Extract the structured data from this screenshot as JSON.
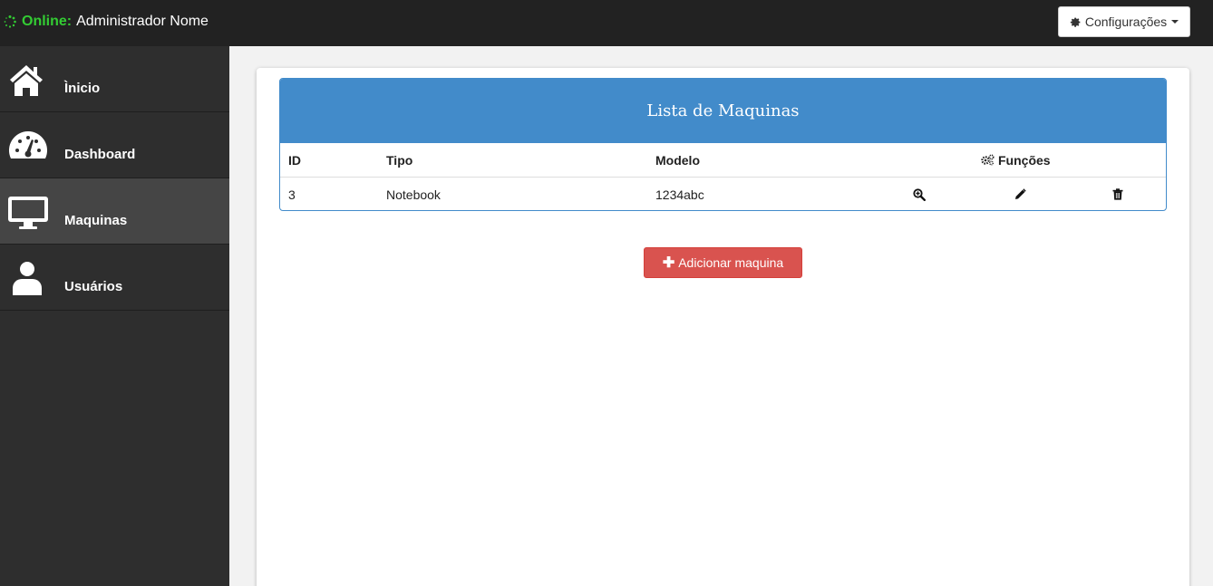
{
  "topbar": {
    "online_label": "Online:",
    "user_name": "Administrador Nome",
    "config_label": "Configurações"
  },
  "sidebar": {
    "items": [
      {
        "label": "Ìnicio",
        "icon": "home-icon"
      },
      {
        "label": "Dashboard",
        "icon": "dashboard-icon"
      },
      {
        "label": "Maquinas",
        "icon": "monitor-icon",
        "active": true
      },
      {
        "label": "Usuários",
        "icon": "user-icon"
      }
    ]
  },
  "table": {
    "title": "Lista de Maquinas",
    "columns": {
      "id": "ID",
      "tipo": "Tipo",
      "modelo": "Modelo",
      "funcoes": "Funções"
    },
    "rows": [
      {
        "id": "3",
        "tipo": "Notebook",
        "modelo": "1234abc"
      }
    ]
  },
  "actions": {
    "add_label": "Adicionar maquina"
  },
  "colors": {
    "topbar": "#222222",
    "sidebar": "#2e2e2e",
    "primary": "#428bca",
    "danger": "#d9534f",
    "online": "#33cc33"
  }
}
